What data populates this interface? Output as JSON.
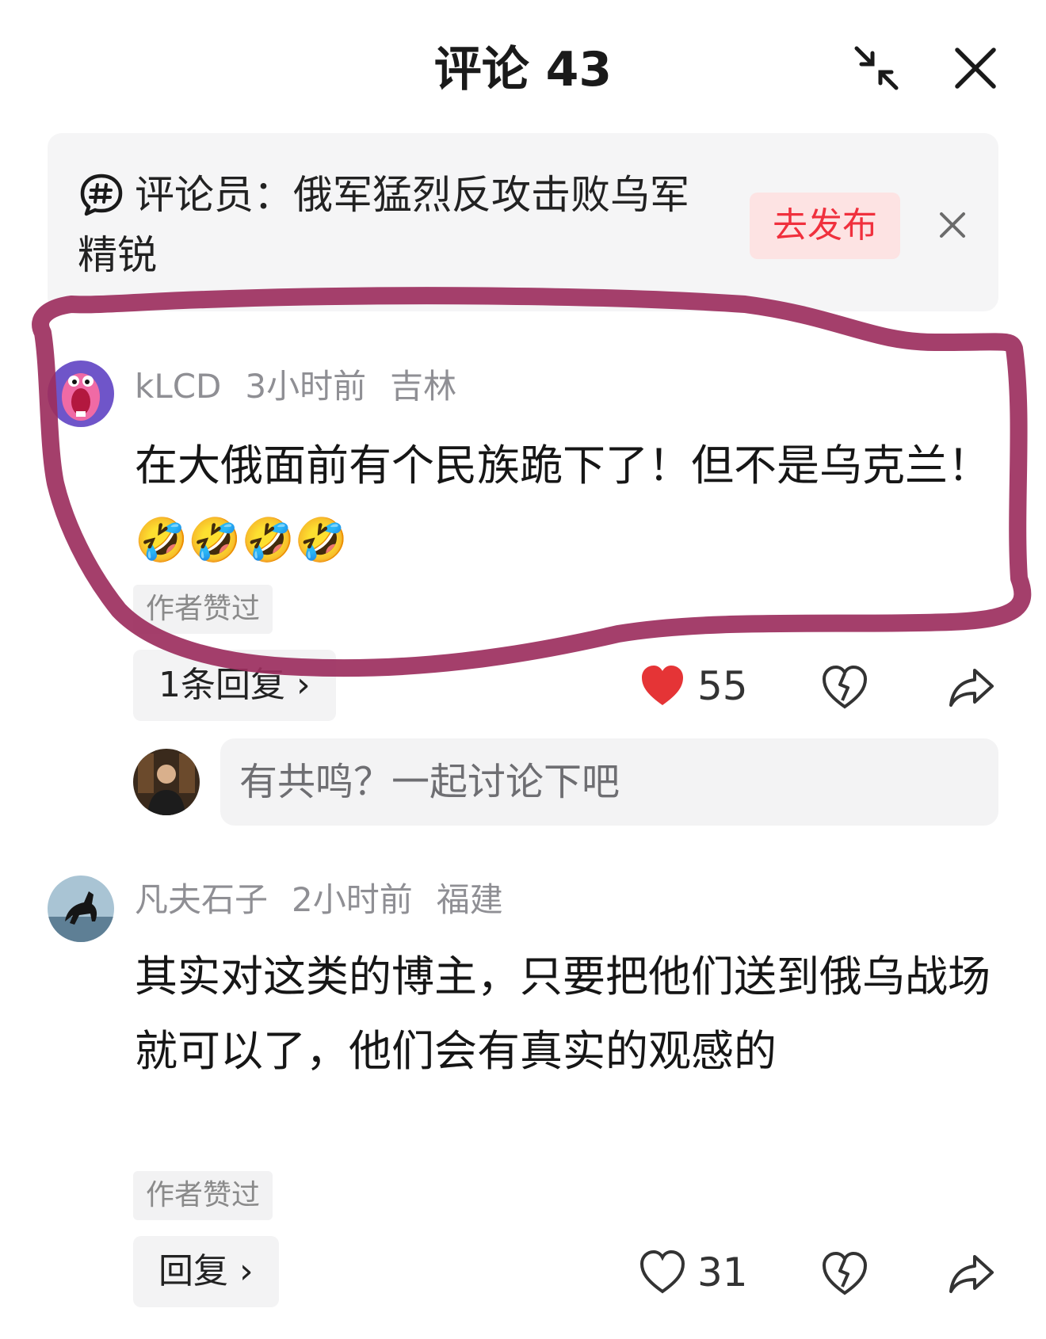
{
  "header": {
    "title": "评论 43",
    "collapse_icon": "collapse-arrows-icon",
    "close_icon": "close-icon"
  },
  "topic": {
    "icon": "hashtag-chat-icon",
    "text": "评论员：俄军猛烈反攻击败乌军精锐",
    "publish_label": "去发布",
    "dismiss_icon": "close-icon"
  },
  "comments": [
    {
      "user": "kLCD",
      "time": "3小时前",
      "location": "吉林",
      "text": "在大俄面前有个民族跪下了！但不是乌克兰！",
      "emoji": [
        "🤣",
        "🤣",
        "🤣",
        "🤣"
      ],
      "tag": "作者赞过",
      "reply_label": "1条回复 ›",
      "likes": "55",
      "liked": true
    },
    {
      "user": "凡夫石子",
      "time": "2小时前",
      "location": "福建",
      "text": "其实对这类的博主，只要把他们送到俄乌战场就可以了，他们会有真实的观感的",
      "tag": "作者赞过",
      "reply_label": "回复 ›",
      "likes": "31",
      "liked": false
    }
  ],
  "reply_input": {
    "placeholder": "有共鸣？一起讨论下吧"
  },
  "colors": {
    "accent_red": "#f0303d",
    "annotation": "#9c2f5e"
  }
}
